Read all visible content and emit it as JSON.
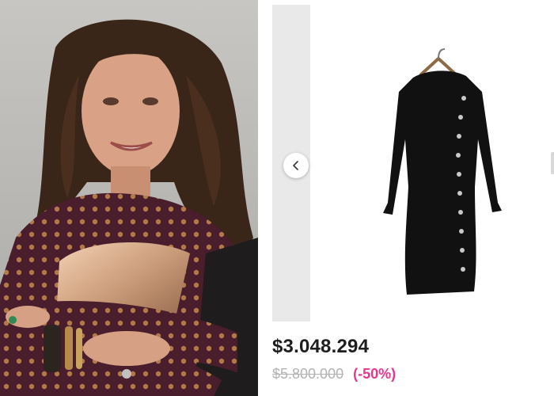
{
  "product": {
    "price": "$3.048.294",
    "original_price": "$5.800.000",
    "discount": "(-50%)"
  },
  "gallery": {
    "prev_icon": "chevron-left-icon"
  },
  "colors": {
    "discount": "#e8358f",
    "price": "#1e1e1e",
    "old_price": "#b3b3b3",
    "dress": "#111111",
    "buttons": "#c9c9c9"
  }
}
